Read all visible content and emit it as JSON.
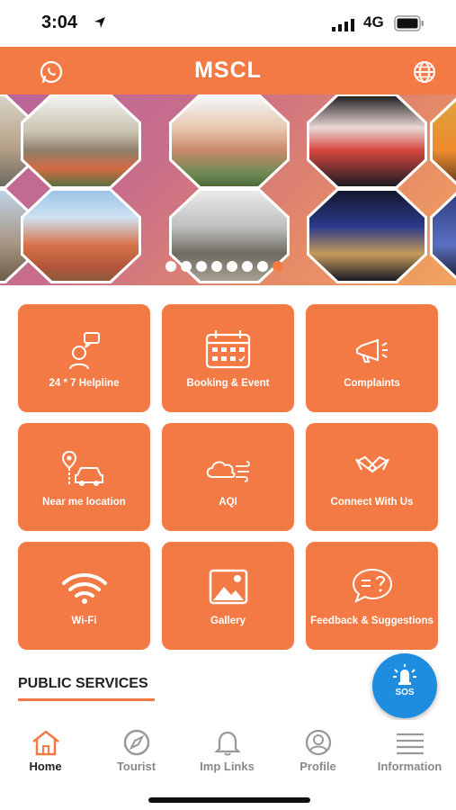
{
  "status": {
    "time": "3:04",
    "network": "4G"
  },
  "header": {
    "title": "MSCL"
  },
  "banner": {
    "dot_count": 8,
    "active_dot": 7
  },
  "tiles": [
    {
      "label": "24 * 7 Helpline",
      "icon": "helpline-icon"
    },
    {
      "label": "Booking & Event",
      "icon": "calendar-icon"
    },
    {
      "label": "Complaints",
      "icon": "megaphone-icon"
    },
    {
      "label": "Near me location",
      "icon": "location-car-icon"
    },
    {
      "label": "AQI",
      "icon": "cloud-wind-icon"
    },
    {
      "label": "Connect With Us",
      "icon": "handshake-icon"
    },
    {
      "label": "Wi-Fi",
      "icon": "wifi-icon"
    },
    {
      "label": "Gallery",
      "icon": "gallery-icon"
    },
    {
      "label": "Feedback & Suggestions",
      "icon": "feedback-icon"
    }
  ],
  "section": {
    "title": "PUBLIC SERVICES"
  },
  "sos": {
    "label": "SOS"
  },
  "nav": [
    {
      "label": "Home",
      "icon": "home-icon"
    },
    {
      "label": "Tourist",
      "icon": "compass-icon"
    },
    {
      "label": "Imp Links",
      "icon": "bell-icon"
    },
    {
      "label": "Profile",
      "icon": "profile-icon"
    },
    {
      "label": "Information",
      "icon": "list-icon"
    }
  ],
  "colors": {
    "accent": "#f47a45",
    "sos": "#1e8de0"
  }
}
